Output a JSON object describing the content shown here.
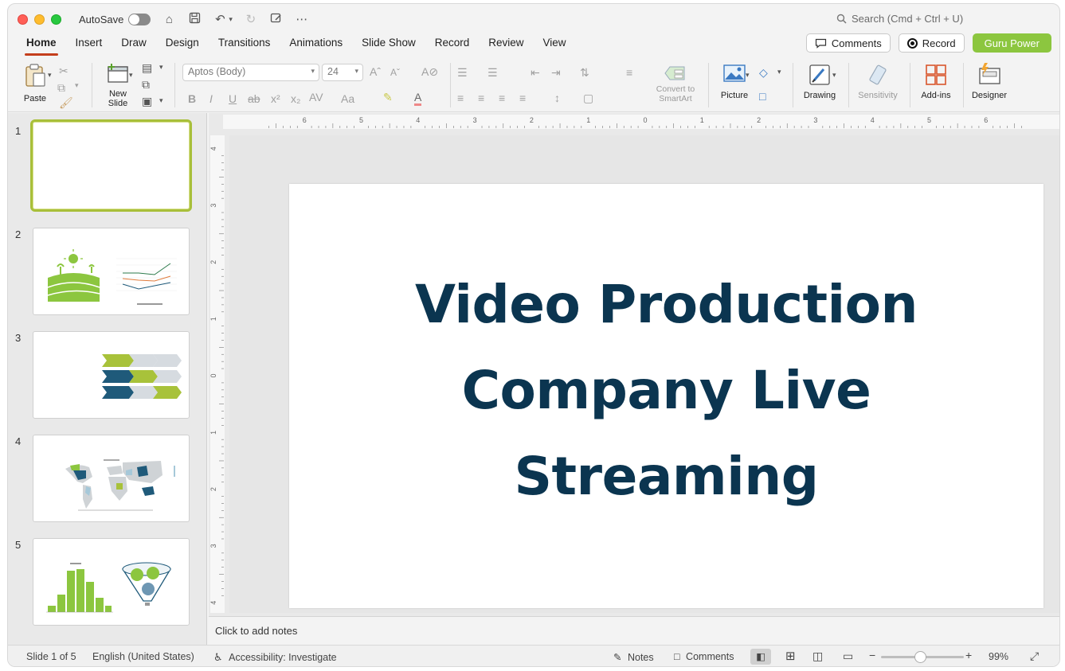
{
  "titlebar": {
    "autosave_label": "AutoSave",
    "search_placeholder": "Search (Cmd + Ctrl + U)"
  },
  "tabs": [
    "Home",
    "Insert",
    "Draw",
    "Design",
    "Transitions",
    "Animations",
    "Slide Show",
    "Record",
    "Review",
    "View"
  ],
  "active_tab": "Home",
  "header_buttons": {
    "comments": "Comments",
    "record": "Record",
    "guru": "Guru Power"
  },
  "ribbon": {
    "paste": "Paste",
    "new_slide": [
      "New",
      "Slide"
    ],
    "font_name": "Aptos (Body)",
    "font_size": "24",
    "convert_smartart": [
      "Convert to",
      "SmartArt"
    ],
    "picture": "Picture",
    "drawing": "Drawing",
    "sensitivity": "Sensitivity",
    "addins": "Add-ins",
    "designer": "Designer"
  },
  "colors": {
    "title_text": "#0b3550",
    "accent_green": "#8cc63f",
    "accent_teal": "#1f5a7a",
    "tab_underline": "#c43e1c"
  },
  "slides": [
    {
      "number": "1",
      "selected": true
    },
    {
      "number": "2"
    },
    {
      "number": "3"
    },
    {
      "number": "4"
    },
    {
      "number": "5"
    }
  ],
  "current_slide": {
    "title_lines": [
      "Video Production",
      "Company Live",
      "Streaming"
    ]
  },
  "notes_placeholder": "Click to add notes",
  "status": {
    "slide_info": "Slide 1 of 5",
    "language": "English (United States)",
    "accessibility": "Accessibility: Investigate",
    "notes": "Notes",
    "comments": "Comments",
    "zoom": "99%"
  }
}
